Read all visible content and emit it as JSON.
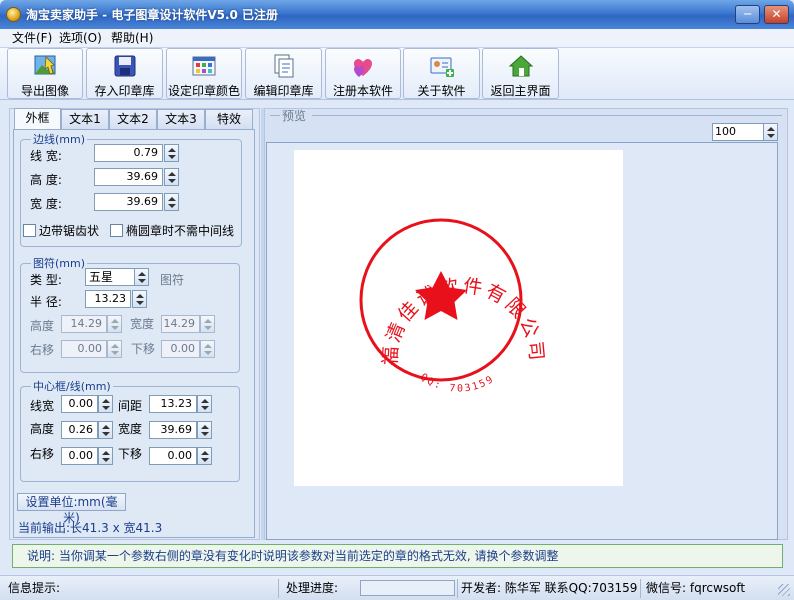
{
  "window": {
    "title": "淘宝卖家助手 - 电子图章设计软件V5.0  已注册",
    "minimize_glyph": "─",
    "close_glyph": "✕"
  },
  "menu": [
    "文件(F)",
    "选项(O)",
    "帮助(H)"
  ],
  "toolbar": [
    {
      "label": "导出图像",
      "icon": "export-image-icon"
    },
    {
      "label": "存入印章库",
      "icon": "save-disk-icon"
    },
    {
      "label": "设定印章颜色",
      "icon": "color-palette-icon"
    },
    {
      "label": "编辑印章库",
      "icon": "edit-library-icon"
    },
    {
      "label": "注册本软件",
      "icon": "hearts-icon"
    },
    {
      "label": "关于软件",
      "icon": "about-card-icon"
    },
    {
      "label": "返回主界面",
      "icon": "home-icon"
    }
  ],
  "tabs": [
    "外框",
    "文本1",
    "文本2",
    "文本3",
    "特效"
  ],
  "border_group": {
    "legend": "边线(mm)",
    "line_width": {
      "label": "线  宽:",
      "value": "0.79"
    },
    "height": {
      "label": "高  度:",
      "value": "39.69"
    },
    "width": {
      "label": "宽  度:",
      "value": "39.69"
    },
    "sawtooth": "边带锯齿状",
    "no_middle_line": "椭圆章时不需中间线"
  },
  "symbol_group": {
    "legend": "图符(mm)",
    "type": {
      "label": "类  型:",
      "value": "五星"
    },
    "symbol_text": "图符",
    "radius": {
      "label": "半  径:",
      "value": "13.23"
    },
    "height": {
      "label": "高度",
      "value": "14.29"
    },
    "width": {
      "label": "宽度",
      "value": "14.29"
    },
    "right_shift": {
      "label": "右移",
      "value": "0.00"
    },
    "down_shift": {
      "label": "下移",
      "value": "0.00"
    }
  },
  "center_group": {
    "legend": "中心框/线(mm)",
    "line_width": {
      "label": "线宽",
      "value": "0.00"
    },
    "spacing": {
      "label": "间距",
      "value": "13.23"
    },
    "height": {
      "label": "高度",
      "value": "0.26"
    },
    "width": {
      "label": "宽度",
      "value": "39.69"
    },
    "right_shift": {
      "label": "右移",
      "value": "0.00"
    },
    "down_shift": {
      "label": "下移",
      "value": "0.00"
    }
  },
  "unit_button": "设置单位:mm(毫米)",
  "output_info": "当前输出:长41.3 x 宽41.3",
  "preview": {
    "label": "预览",
    "zoom": "100"
  },
  "stamp": {
    "company_text": "福清佳诚软件有限公司",
    "qq_text": "QQ: 703159",
    "color": "#e8101a"
  },
  "note": "说明: 当你调某一个参数右侧的章没有变化时说明该参数对当前选定的章的格式无效, 请换个参数调整",
  "status": {
    "info_label": "信息提示:",
    "progress_label": "处理进度:",
    "developer": "开发者: 陈华军 联系QQ:703159",
    "wechat": "微信号: fqrcwsoft"
  }
}
